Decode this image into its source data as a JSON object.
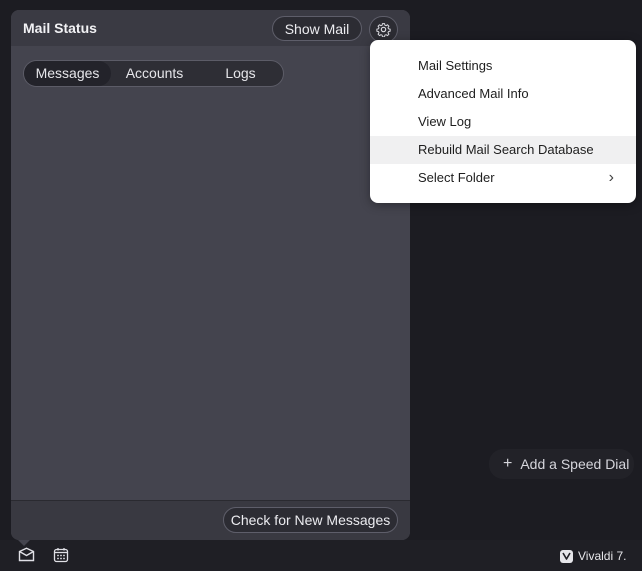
{
  "panel": {
    "title": "Mail Status",
    "show_mail_label": "Show Mail",
    "tabs": [
      {
        "label": "Messages"
      },
      {
        "label": "Accounts"
      },
      {
        "label": "Logs"
      }
    ],
    "check_label": "Check for New Messages"
  },
  "menu": {
    "items": [
      {
        "label": "Mail Settings"
      },
      {
        "label": "Advanced Mail Info"
      },
      {
        "label": "View Log"
      },
      {
        "label": "Rebuild Mail Search Database"
      },
      {
        "label": "Select Folder"
      }
    ]
  },
  "speed_dial": {
    "label": "Add a Speed Dial"
  },
  "statusbar": {
    "version": "Vivaldi 7."
  },
  "icons": {
    "settings": "gear-icon",
    "chevron": "chevron-right-icon",
    "plus": "plus-icon",
    "mail": "mail-icon",
    "calendar": "calendar-icon",
    "logo": "vivaldi-logo-icon"
  },
  "colors": {
    "panel_bg": "#44444e",
    "page_bg": "#1c1c22",
    "menu_bg": "#ffffff",
    "menu_hover": "#f0f0f1"
  }
}
